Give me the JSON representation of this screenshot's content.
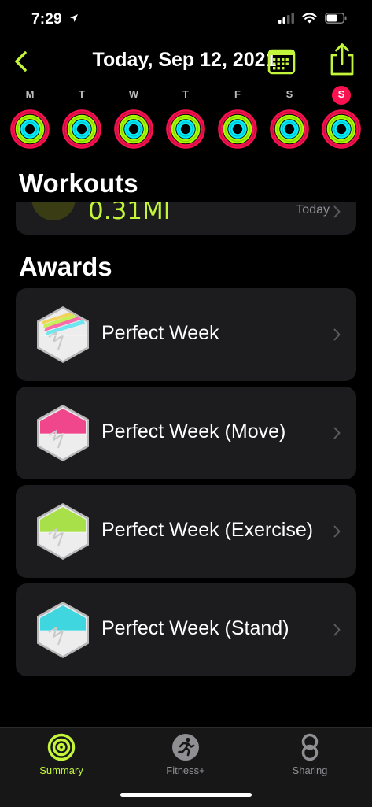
{
  "status": {
    "time": "7:29"
  },
  "nav": {
    "title": "Today, Sep 12, 2021"
  },
  "week": {
    "days": [
      {
        "letter": "M"
      },
      {
        "letter": "T"
      },
      {
        "letter": "W"
      },
      {
        "letter": "T"
      },
      {
        "letter": "F"
      },
      {
        "letter": "S"
      },
      {
        "letter": "S",
        "today": true
      }
    ]
  },
  "workouts": {
    "title": "Workouts",
    "distance": "0.31MI",
    "date": "Today"
  },
  "awards": {
    "title": "Awards",
    "items": [
      {
        "label": "Perfect Week",
        "badge": "multicolor"
      },
      {
        "label": "Perfect Week (Move)",
        "badge": "pink"
      },
      {
        "label": "Perfect Week (Exercise)",
        "badge": "green"
      },
      {
        "label": "Perfect Week (Stand)",
        "badge": "cyan"
      }
    ]
  },
  "tabs": [
    {
      "label": "Summary",
      "icon": "rings-icon",
      "active": true
    },
    {
      "label": "Fitness+",
      "icon": "runner-icon"
    },
    {
      "label": "Sharing",
      "icon": "sharing-icon"
    }
  ],
  "colors": {
    "accent": "#c3f63a",
    "move": "#fa114f",
    "exercise": "#a6ff00",
    "stand": "#00f0ff",
    "card": "#1c1c1e"
  }
}
